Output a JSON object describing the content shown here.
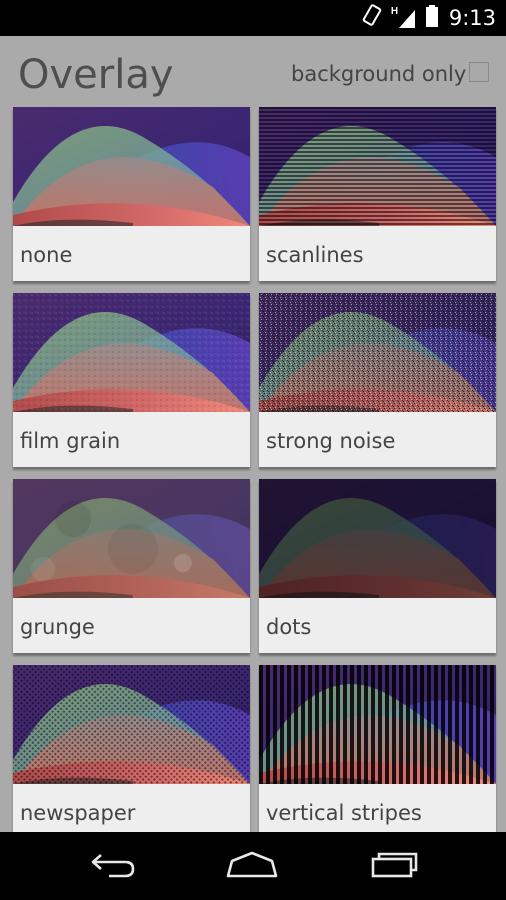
{
  "status_bar": {
    "time": "9:13",
    "network_type": "H",
    "icons": [
      "rotation-lock-icon",
      "signal-icon",
      "battery-icon"
    ]
  },
  "header": {
    "title": "Overlay",
    "background_only_label": "background only",
    "background_only_checked": false
  },
  "overlays": [
    {
      "label": "none",
      "pattern": "none"
    },
    {
      "label": "scanlines",
      "pattern": "scanlines"
    },
    {
      "label": "film grain",
      "pattern": "grain"
    },
    {
      "label": "strong noise",
      "pattern": "noise"
    },
    {
      "label": "grunge",
      "pattern": "grunge"
    },
    {
      "label": "dots",
      "pattern": "dots"
    },
    {
      "label": "newspaper",
      "pattern": "newspaper"
    },
    {
      "label": "vertical stripes",
      "pattern": "vstripes"
    }
  ],
  "nav_bar": {
    "icons": [
      "back-icon",
      "home-icon",
      "recents-icon"
    ]
  }
}
